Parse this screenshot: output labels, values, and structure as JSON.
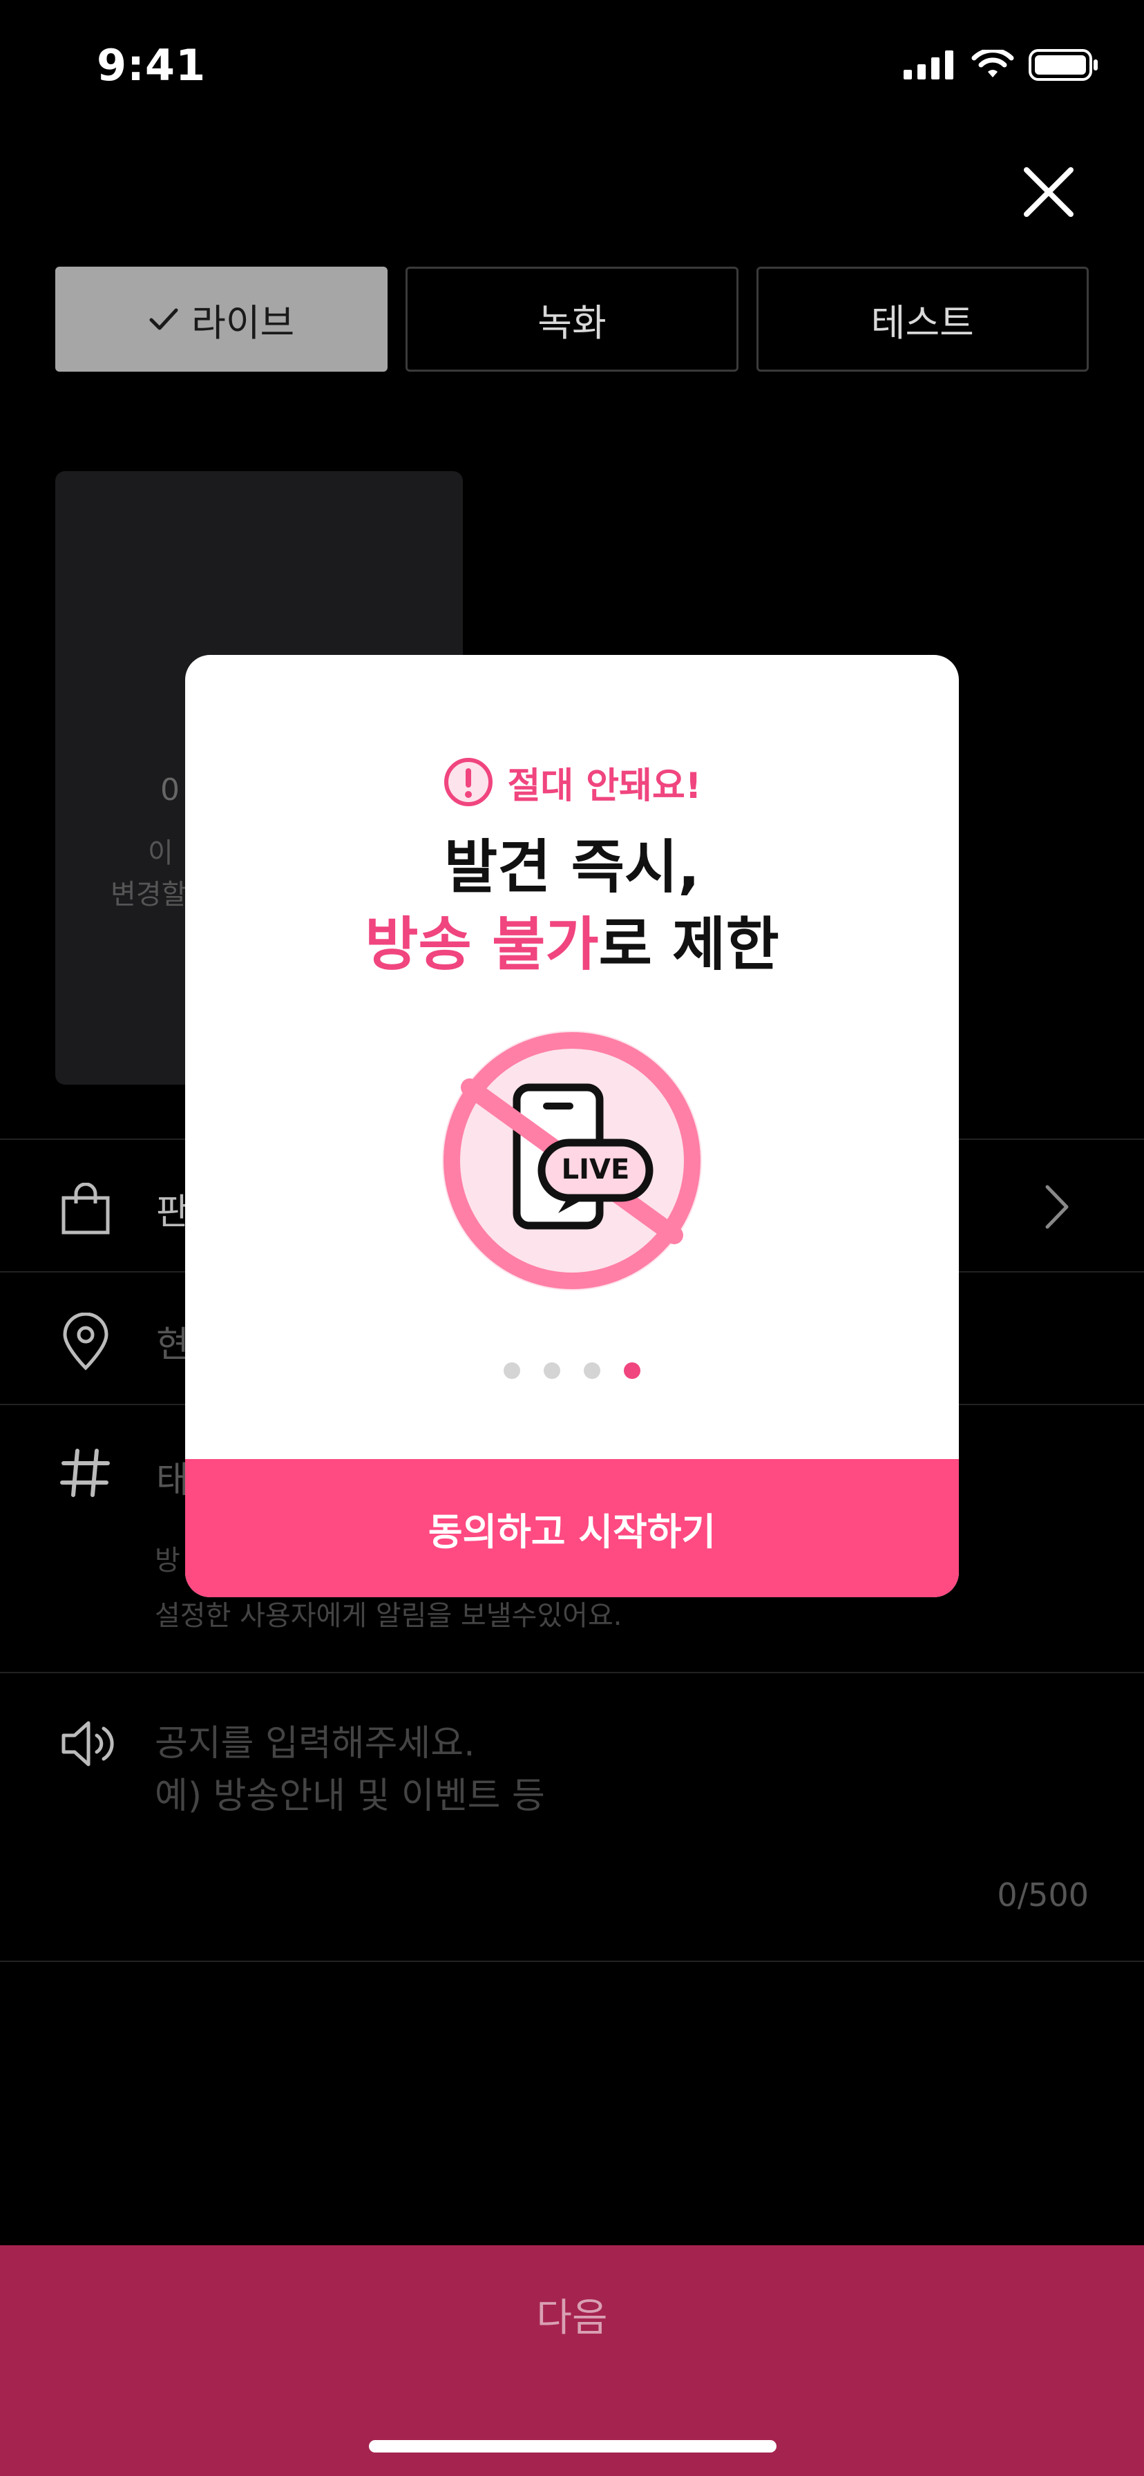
{
  "status_bar": {
    "time": "9:41"
  },
  "tabs": [
    {
      "label": "라이브",
      "active": true
    },
    {
      "label": "녹화",
      "active": false
    },
    {
      "label": "테스트",
      "active": false
    }
  ],
  "background": {
    "thumb_fragments": [
      "0",
      "이",
      "변경할"
    ],
    "product_row_fragment": "판",
    "location_row_fragment": "현",
    "tag_row_fragment": "태",
    "tag_desc_line1": "방",
    "tag_desc_line2": "설정한 사용자에게 알림을 보낼수있어요.",
    "notice_placeholder_line1": "공지를 입력해주세요.",
    "notice_placeholder_line2": "예) 방송안내 및 이벤트 등",
    "char_count": "0/500"
  },
  "modal": {
    "warning": "절대 안돼요!",
    "title_line1": "발견 즉시,",
    "title_highlight": "방송 불가",
    "title_rest": "로 제한",
    "illustration_badge": "LIVE",
    "page_count": 4,
    "current_page": 4,
    "cta_label": "동의하고 시작하기"
  },
  "next_button": {
    "label": "다음"
  },
  "colors": {
    "accent": "#f0457f",
    "cta": "#ff4a82",
    "next_bar": "#a5244f",
    "active_tab": "#a6a6a6"
  },
  "icons": [
    "close-icon",
    "check-icon",
    "shopping-bag-icon",
    "location-pin-icon",
    "hashtag-icon",
    "speaker-icon",
    "chevron-right-icon",
    "exclamation-circle-icon",
    "no-live-icon"
  ]
}
